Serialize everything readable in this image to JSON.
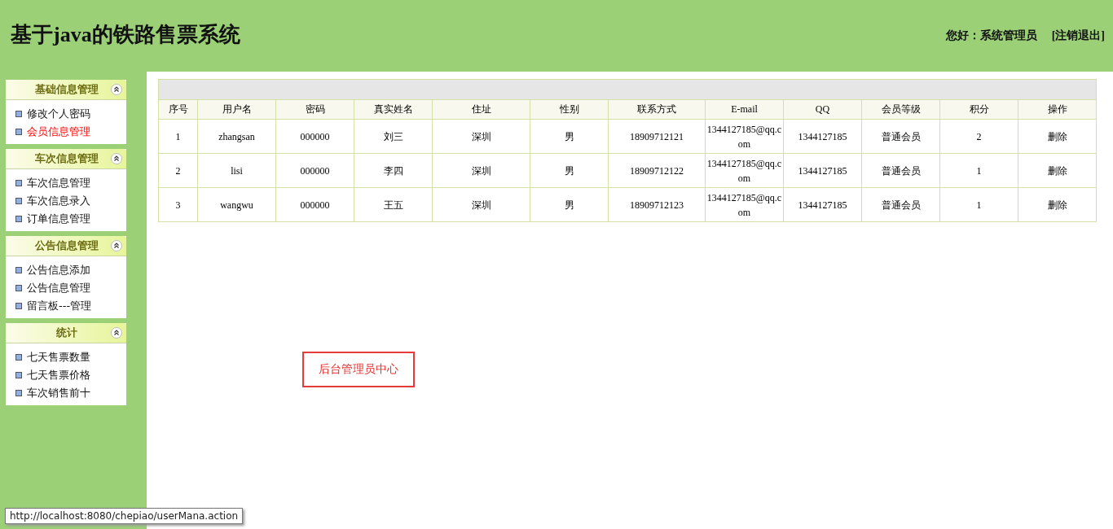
{
  "header": {
    "title": "基于java的铁路售票系统",
    "greeting": "您好：系统管理员",
    "logout": "[注销退出]"
  },
  "sidebar": {
    "groups": [
      {
        "title": "基础信息管理",
        "items": [
          {
            "label": "修改个人密码",
            "selected": false
          },
          {
            "label": "会员信息管理",
            "selected": true
          }
        ]
      },
      {
        "title": "车次信息管理",
        "items": [
          {
            "label": "车次信息管理",
            "selected": false
          },
          {
            "label": "车次信息录入",
            "selected": false
          },
          {
            "label": "订单信息管理",
            "selected": false
          }
        ]
      },
      {
        "title": "公告信息管理",
        "items": [
          {
            "label": "公告信息添加",
            "selected": false
          },
          {
            "label": "公告信息管理",
            "selected": false
          },
          {
            "label": "留言板---管理",
            "selected": false
          }
        ]
      },
      {
        "title": "统计",
        "items": [
          {
            "label": "七天售票数量",
            "selected": false
          },
          {
            "label": "七天售票价格",
            "selected": false
          },
          {
            "label": "车次销售前十",
            "selected": false
          }
        ]
      }
    ]
  },
  "table": {
    "columns": [
      "序号",
      "用户名",
      "密码",
      "真实姓名",
      "住址",
      "性别",
      "联系方式",
      "E-mail",
      "QQ",
      "会员等级",
      "积分",
      "操作"
    ],
    "rows": [
      [
        "1",
        "zhangsan",
        "000000",
        "刘三",
        "深圳",
        "男",
        "18909712121",
        "1344127185@qq.com",
        "1344127185",
        "普通会员",
        "2",
        "删除"
      ],
      [
        "2",
        "lisi",
        "000000",
        "李四",
        "深圳",
        "男",
        "18909712122",
        "1344127185@qq.com",
        "1344127185",
        "普通会员",
        "1",
        "删除"
      ],
      [
        "3",
        "wangwu",
        "000000",
        "王五",
        "深圳",
        "男",
        "18909712123",
        "1344127185@qq.com",
        "1344127185",
        "普通会员",
        "1",
        "删除"
      ]
    ]
  },
  "center_label": "后台管理员中心",
  "status_bar": {
    "url": "http://localhost:8080/chepiao/userMana.action"
  }
}
